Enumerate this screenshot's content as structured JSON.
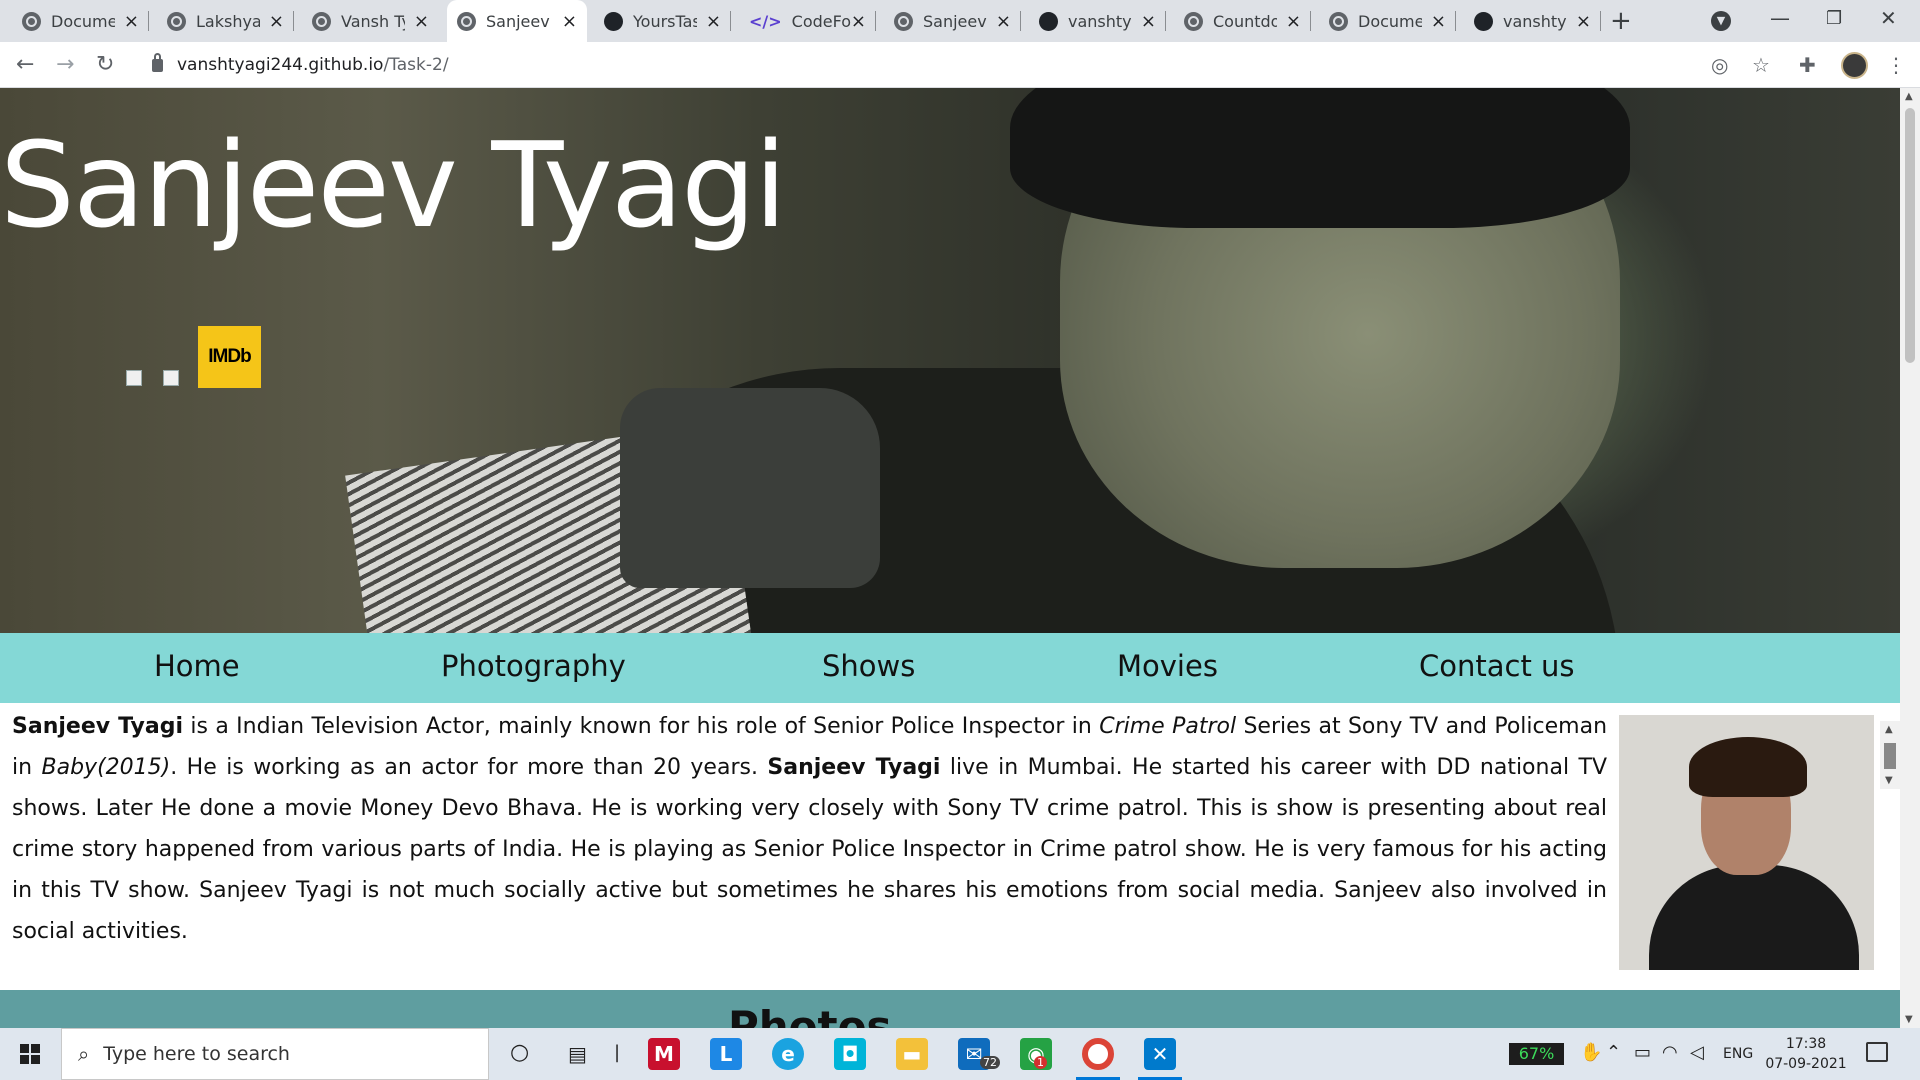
{
  "browser": {
    "tabs": [
      {
        "title": "Documen",
        "icon": "globe"
      },
      {
        "title": "Lakshya",
        "icon": "globe"
      },
      {
        "title": "Vansh Tya",
        "icon": "globe"
      },
      {
        "title": "Sanjeev T",
        "icon": "globe",
        "active": true
      },
      {
        "title": "YoursTast",
        "icon": "github"
      },
      {
        "title": "CodeForm",
        "icon": "code"
      },
      {
        "title": "Sanjeev T",
        "icon": "globe"
      },
      {
        "title": "vanshtyag",
        "icon": "github"
      },
      {
        "title": "Countdow",
        "icon": "globe"
      },
      {
        "title": "Documen",
        "icon": "globe"
      },
      {
        "title": "vanshtyag",
        "icon": "github"
      }
    ],
    "url_domain": "vanshtyagi244.github.io",
    "url_path": "/Task-2/"
  },
  "hero": {
    "title": "Sanjeev Tyagi",
    "imdb_label": "IMDb"
  },
  "nav": {
    "items": [
      "Home",
      "Photography",
      "Shows",
      "Movies",
      "Contact us"
    ]
  },
  "bio": {
    "name": "Sanjeev Tyagi",
    "t1": " is a Indian Television Actor, mainly known for his role of Senior Police Inspector in ",
    "show": "Crime Patrol",
    "t2": " Series at Sony TV and Policeman in ",
    "movie": "Baby(2015)",
    "t3": ". He is working as an actor for more than 20 years. ",
    "name2": "Sanjeev Tyagi",
    "t4": " live in Mumbai. He started his career with DD national TV shows. Later He done a movie Money Devo Bhava. He is working very closely with Sony TV crime patrol. This is show is presenting about real crime story happened from various parts of India. He is playing as Senior Police Inspector in Crime patrol show. He is very famous for his acting in this TV show. Sanjeev Tyagi is not much socially active but sometimes he shares his emotions from social media. Sanjeev also involved in social activities."
  },
  "photos": {
    "heading": "Photos"
  },
  "taskbar": {
    "search_placeholder": "Type here to search",
    "mail_badge": "72",
    "app_badge": "1",
    "battery": "67%",
    "lang": "ENG",
    "time": "17:38",
    "date": "07-09-2021"
  },
  "colors": {
    "nav_bg": "#84d8d6",
    "photos_bg": "#5f9ea0",
    "imdb": "#f5c518"
  }
}
